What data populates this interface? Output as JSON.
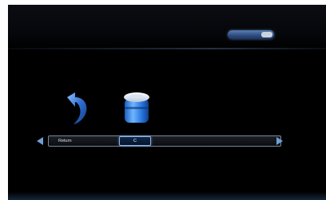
{
  "status": {
    "text": ""
  },
  "menu": {
    "items": [
      {
        "icon": "return-arrow-icon"
      },
      {
        "icon": "trash-can-icon"
      }
    ]
  },
  "selector": {
    "label": "Return",
    "value": "C"
  },
  "colors": {
    "background": "#000000",
    "accent": "#6f9fd8",
    "highlight_border": "#8fb4e8"
  }
}
